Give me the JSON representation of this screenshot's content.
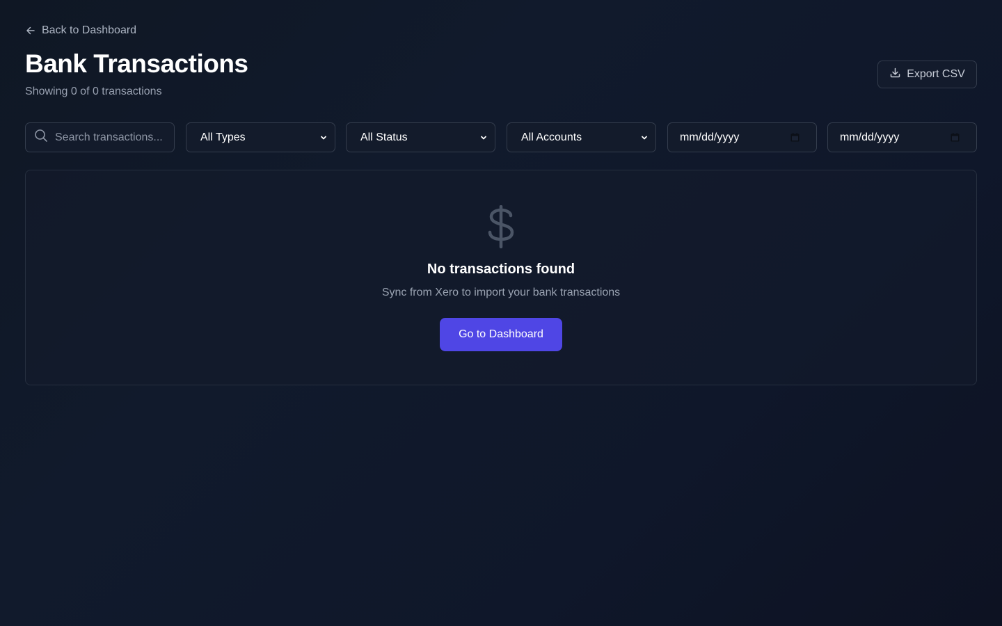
{
  "nav": {
    "back_label": "Back to Dashboard"
  },
  "header": {
    "title": "Bank Transactions",
    "subtitle": "Showing 0 of 0 transactions",
    "export_label": "Export CSV"
  },
  "filters": {
    "search_placeholder": "Search transactions...",
    "type_selected": "All Types",
    "status_selected": "All Status",
    "account_selected": "All Accounts",
    "date_from_placeholder": "mm/dd/yyyy",
    "date_to_placeholder": "mm/dd/yyyy"
  },
  "empty_state": {
    "icon": "dollar-sign-icon",
    "title": "No transactions found",
    "message": "Sync from Xero to import your bank transactions",
    "cta_label": "Go to Dashboard"
  },
  "colors": {
    "accent": "#4f46e5",
    "background": "#0f172a",
    "muted_text": "#9aa3b2"
  }
}
